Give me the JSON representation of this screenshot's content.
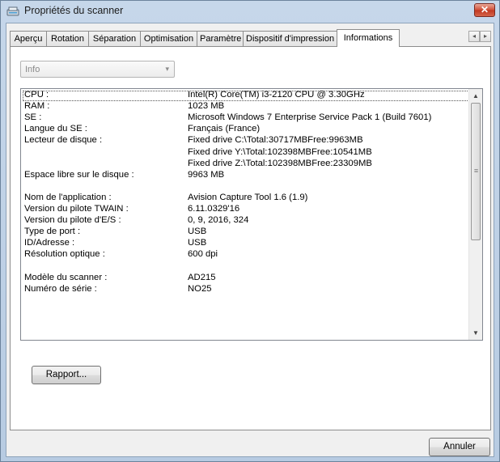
{
  "window": {
    "title": "Propriétés du scanner",
    "close_glyph": "✕"
  },
  "tabs": [
    {
      "label": "Aperçu"
    },
    {
      "label": "Rotation"
    },
    {
      "label": "Séparation"
    },
    {
      "label": "Optimisation"
    },
    {
      "label": "Paramètre"
    },
    {
      "label": "Dispositif d'impression"
    },
    {
      "label": "Informations"
    }
  ],
  "active_tab": "Informations",
  "tab_scroll": {
    "left": "◂",
    "right": "▸"
  },
  "info_select": {
    "value": "Info",
    "arrow": "▾"
  },
  "info_rows": [
    {
      "label": "CPU :",
      "value": "Intel(R) Core(TM) i3-2120 CPU @ 3.30GHz"
    },
    {
      "label": "RAM :",
      "value": "1023 MB"
    },
    {
      "label": "SE :",
      "value": "Microsoft Windows 7 Enterprise Service Pack 1 (Build 7601)"
    },
    {
      "label": "Langue du SE :",
      "value": "Français (France)"
    },
    {
      "label": "Lecteur de disque :",
      "value": "Fixed drive C:\\Total:30717MBFree:9963MB"
    },
    {
      "label": "",
      "value": "Fixed drive Y:\\Total:102398MBFree:10541MB"
    },
    {
      "label": "",
      "value": "Fixed drive Z:\\Total:102398MBFree:23309MB"
    },
    {
      "label": "Espace libre sur le disque :",
      "value": "9963 MB"
    },
    {
      "label": "",
      "value": ""
    },
    {
      "label": "Nom de l'application :",
      "value": "Avision Capture Tool 1.6 (1.9)"
    },
    {
      "label": "Version du pilote TWAIN :",
      "value": "6.11.0329'16"
    },
    {
      "label": "Version du pilote d'E/S :",
      "value": "0, 9, 2016, 324"
    },
    {
      "label": "Type de port :",
      "value": "USB"
    },
    {
      "label": "ID/Adresse :",
      "value": "USB"
    },
    {
      "label": "Résolution optique :",
      "value": "600 dpi"
    },
    {
      "label": "",
      "value": ""
    },
    {
      "label": "Modèle du scanner :",
      "value": "AD215"
    },
    {
      "label": "Numéro de série :",
      "value": "NO25"
    }
  ],
  "scrollbar": {
    "up": "▲",
    "down": "▼",
    "grip": "≡"
  },
  "buttons": {
    "report": "Rapport...",
    "cancel": "Annuler"
  }
}
